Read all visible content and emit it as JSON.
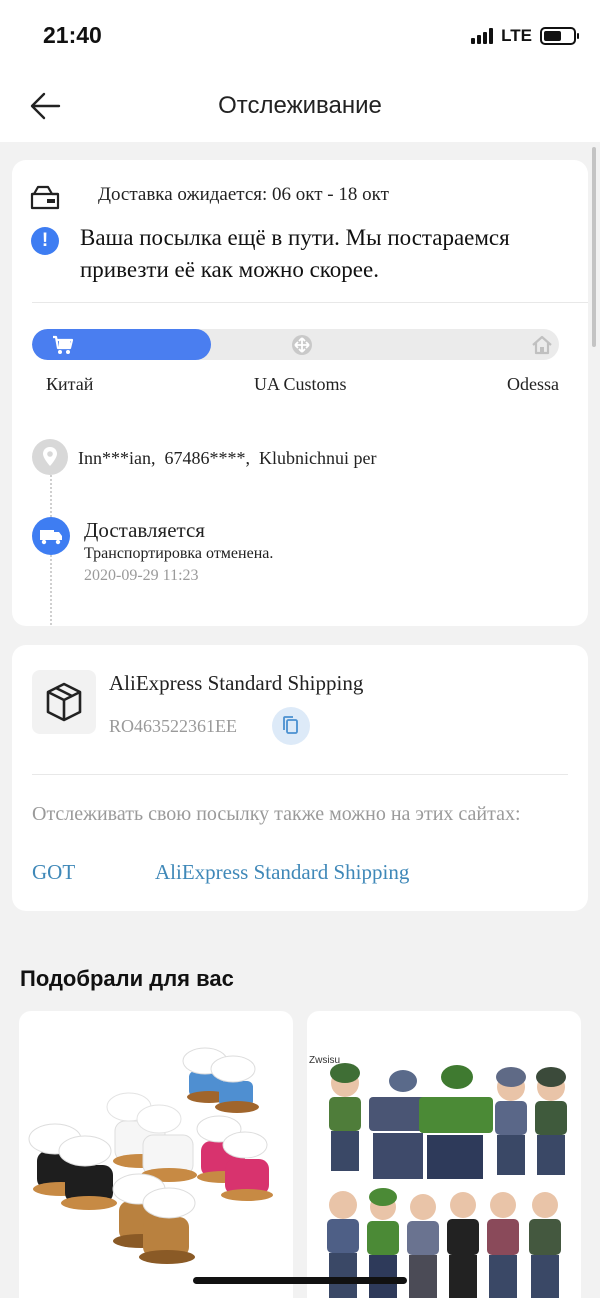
{
  "status_bar": {
    "time": "21:40",
    "network": "LTE"
  },
  "header": {
    "title": "Отслеживание",
    "back_icon": "arrow-left-icon"
  },
  "tracking": {
    "delivery_estimate": "Доставка ожидается: 06 окт - 18 окт",
    "notice": "Ваша посылка ещё в пути. Мы постараемся привезти её как можно скорее.",
    "progress": {
      "fraction": 0.34,
      "locations": [
        "Китай",
        "UA Customs",
        "Odessa"
      ]
    },
    "address": "Inn***ian,  67486****,  Klubnichnui per",
    "event": {
      "title": "Доставляется",
      "description": "Транспортировка отменена.",
      "timestamp": "2020-09-29 11:23"
    }
  },
  "shipping": {
    "carrier": "AliExpress Standard Shipping",
    "tracking_number": "RO463522361EE",
    "also_track_text": "Отслеживать свою посылку также можно на этих сайтах:",
    "links": [
      "GOT",
      "AliExpress Standard Shipping"
    ]
  },
  "recommendations": {
    "title": "Подобрали для вас",
    "products": [
      {
        "image": "doll-boots-product-image"
      },
      {
        "image": "doll-clothes-product-image",
        "brand_mark": "Zwsisu"
      }
    ]
  },
  "colors": {
    "accent": "#4a7ef0",
    "link": "#3f88b8",
    "muted": "#9a9a9a"
  }
}
